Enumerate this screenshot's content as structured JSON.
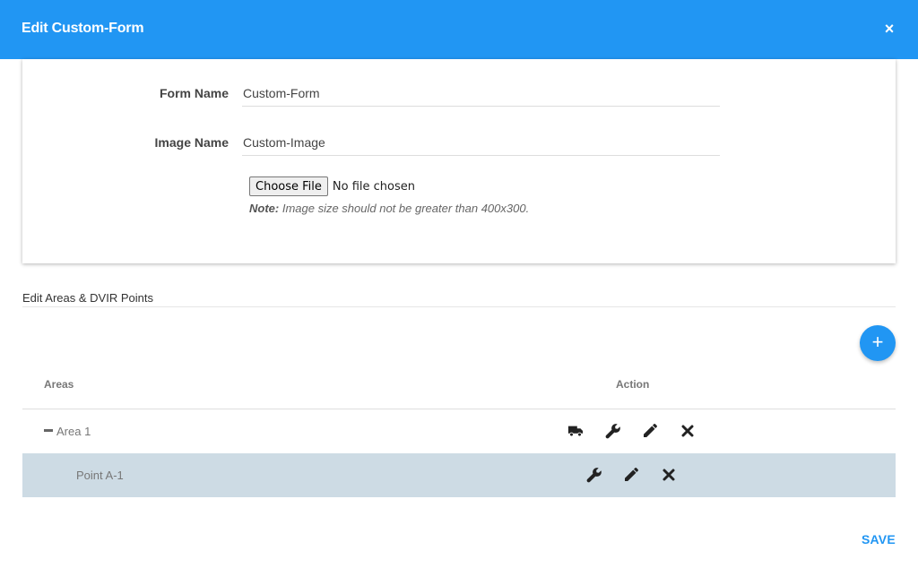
{
  "dialog": {
    "title": "Edit Custom-Form",
    "close_glyph": "×"
  },
  "form": {
    "form_name_label": "Form Name",
    "form_name_value": "Custom-Form",
    "image_name_label": "Image Name",
    "image_name_value": "Custom-Image",
    "file_button_label": "Choose File",
    "file_status": "No file chosen",
    "note_label": "Note:",
    "note_text": " Image size should not be greater than 400x300."
  },
  "areas_section": {
    "title": "Edit Areas & DVIR Points",
    "add_glyph": "+",
    "columns": {
      "areas": "Areas",
      "action": "Action"
    },
    "rows": [
      {
        "type": "area",
        "label": "Area 1",
        "actions": [
          "truck-icon",
          "wrench-icon",
          "pencil-icon",
          "delete-icon"
        ]
      },
      {
        "type": "point",
        "label": "Point A-1",
        "actions": [
          "wrench-icon",
          "pencil-icon",
          "delete-icon"
        ]
      }
    ]
  },
  "footer": {
    "save_label": "SAVE"
  },
  "colors": {
    "primary": "#2196f3",
    "selected_row": "#cddbe4"
  }
}
